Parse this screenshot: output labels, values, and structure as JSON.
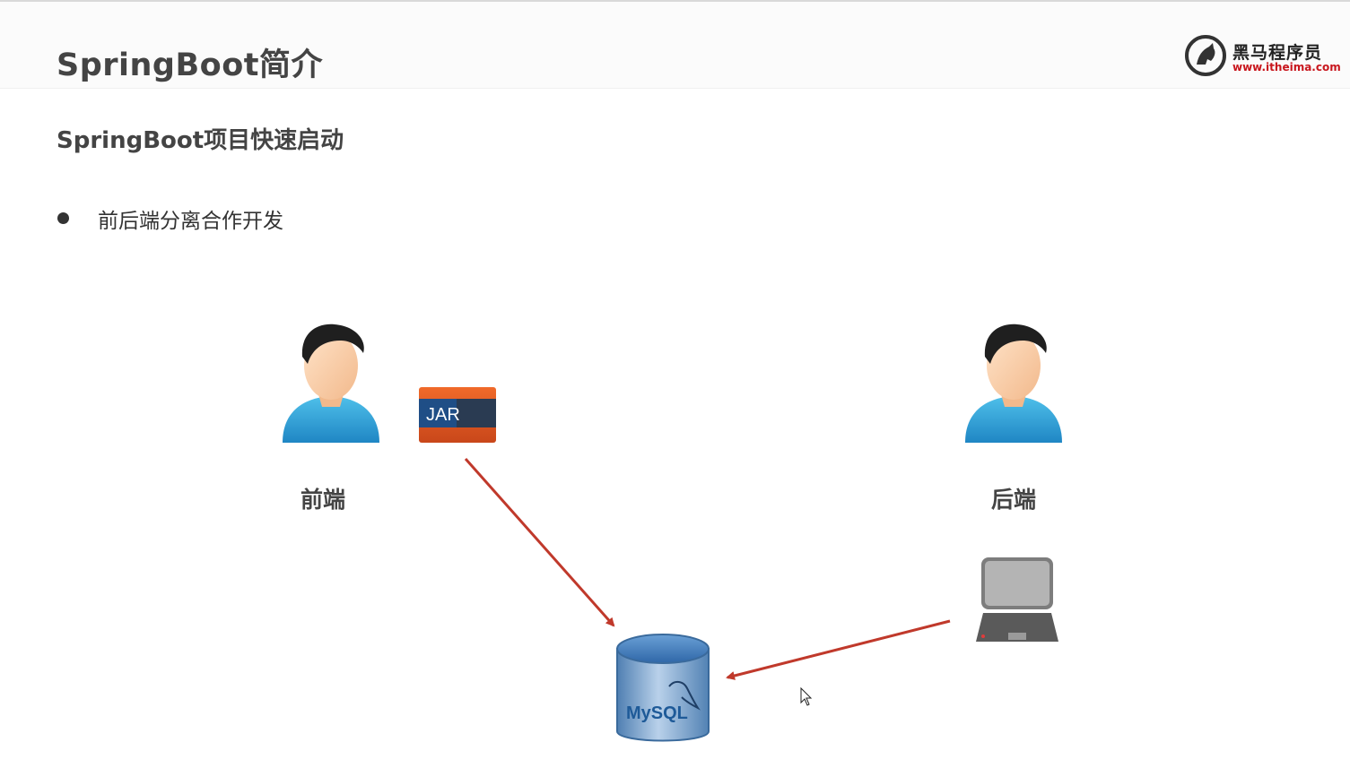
{
  "header": {
    "title": "SpringBoot简介",
    "logo": {
      "name": "黑马程序员",
      "url": "www.itheima.com",
      "icon": "horse-logo-icon"
    }
  },
  "subtitle": "SpringBoot项目快速启动",
  "bullets": [
    {
      "text": "前后端分离合作开发"
    }
  ],
  "diagram": {
    "frontend_label": "前端",
    "backend_label": "后端",
    "jar_label": "JAR",
    "db_label": "MySQL",
    "icons": [
      "person-icon",
      "jar-icon",
      "laptop-icon",
      "database-icon"
    ],
    "arrow_color": "#c0392b"
  }
}
